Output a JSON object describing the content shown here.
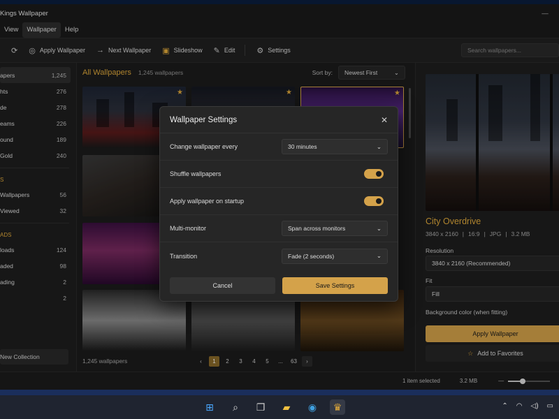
{
  "app": {
    "title": "Kings Wallpaper",
    "min": "—"
  },
  "menu": {
    "view": "View",
    "wallpaper": "Wallpaper",
    "help": "Help"
  },
  "toolbar": {
    "apply": "Apply Wallpaper",
    "next": "Next Wallpaper",
    "slideshow": "Slideshow",
    "edit": "Edit",
    "settings": "Settings",
    "search_placeholder": "Search wallpapers..."
  },
  "sidebar": {
    "items": [
      {
        "label": "apers",
        "count": "1,245"
      },
      {
        "label": "hts",
        "count": "276"
      },
      {
        "label": "de",
        "count": "278"
      },
      {
        "label": "eams",
        "count": "226"
      },
      {
        "label": "ound",
        "count": "189"
      },
      {
        "label": "Gold",
        "count": "240"
      }
    ],
    "head1": "S",
    "items2": [
      {
        "label": "Wallpapers",
        "count": "56"
      },
      {
        "label": "Viewed",
        "count": "32"
      }
    ],
    "head2": "ADS",
    "items3": [
      {
        "label": "loads",
        "count": "124"
      },
      {
        "label": "aded",
        "count": "98"
      },
      {
        "label": "ading",
        "count": "2"
      },
      {
        "label": "",
        "count": "2"
      }
    ],
    "new_collection": "New Collection"
  },
  "main": {
    "title": "All Wallpapers",
    "count": "1,245 wallpapers",
    "sort_label": "Sort by:",
    "sort_value": "Newest First",
    "footer_count": "1,245 wallpapers",
    "pages": [
      "1",
      "2",
      "3",
      "4",
      "5",
      "...",
      "63"
    ]
  },
  "dialog": {
    "title": "Wallpaper Settings",
    "change_label": "Change wallpaper every",
    "change_value": "30 minutes",
    "shuffle_label": "Shuffle wallpapers",
    "startup_label": "Apply wallpaper on startup",
    "monitor_label": "Multi-monitor",
    "monitor_value": "Span across monitors",
    "transition_label": "Transition",
    "transition_value": "Fade (2 seconds)",
    "cancel": "Cancel",
    "save": "Save Settings"
  },
  "preview": {
    "title": "City Overdrive",
    "resolution": "3840 x 2160",
    "ratio": "16:9",
    "format": "JPG",
    "size": "3.2 MB",
    "resolution_label": "Resolution",
    "resolution_value": "3840 x 2160  (Recommended)",
    "fit_label": "Fit",
    "fit_value": "Fill",
    "bg_label": "Background color (when fitting)",
    "apply": "Apply Wallpaper",
    "favorite": "Add to Favorites"
  },
  "status": {
    "selected": "1 item selected",
    "size": "3.2 MB",
    "zoom_fraction": 0.35
  },
  "colors": {
    "accent": "#d4a24a",
    "background": "#1c1c1c"
  }
}
